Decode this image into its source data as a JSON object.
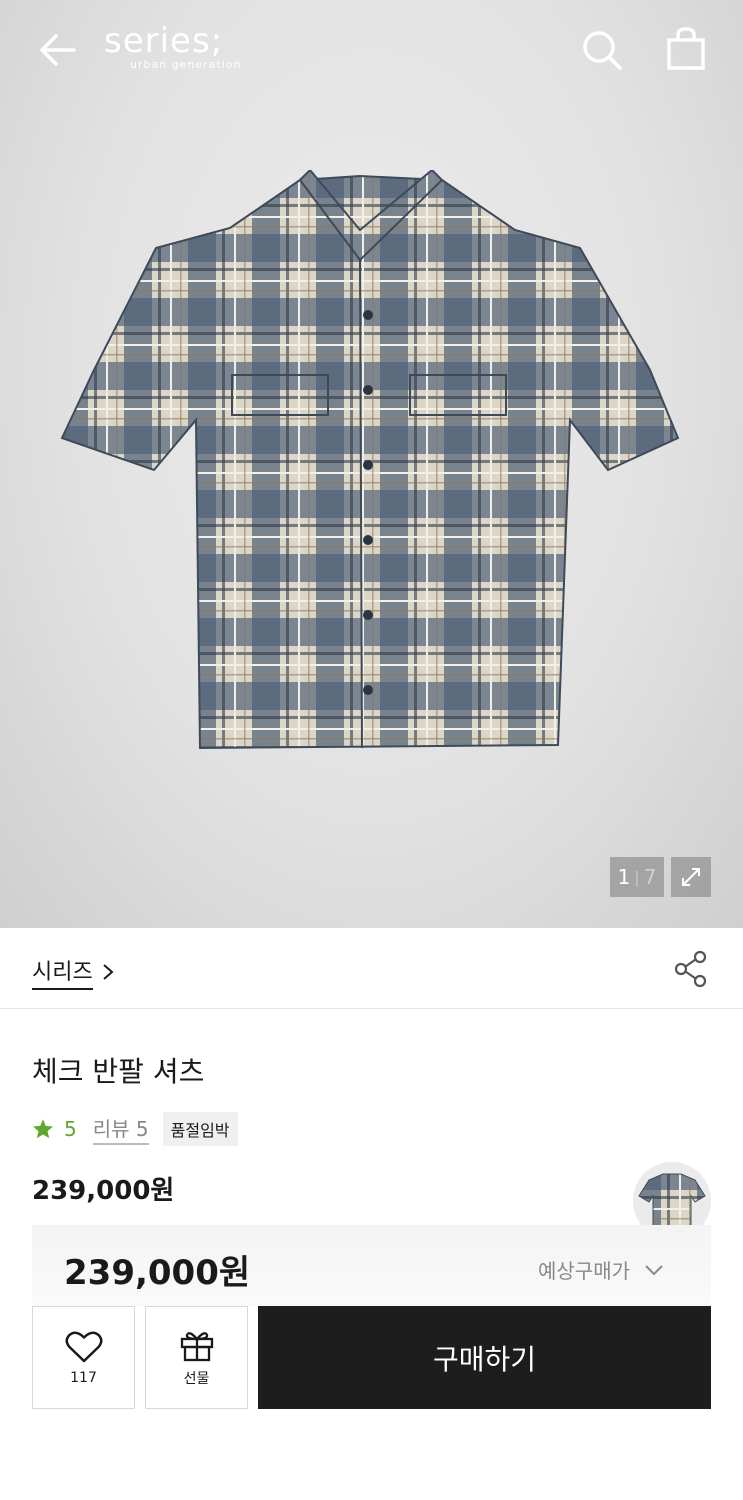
{
  "header": {
    "logo_main": "series;",
    "logo_sub": "urban generation",
    "back_icon": "arrow-left-icon",
    "search_icon": "search-icon",
    "bag_icon": "shopping-bag-icon"
  },
  "gallery": {
    "current": "1",
    "separator": "|",
    "total": "7",
    "expand_icon": "expand-icon"
  },
  "brand": {
    "name": "시리즈",
    "share_icon": "share-icon"
  },
  "product": {
    "title": "체크 반팔 셔츠",
    "rating": "5",
    "review_label": "리뷰 5",
    "badge": "품절임박",
    "price": "239,000원"
  },
  "purchase_bar": {
    "estimated_price": "239,000원",
    "estimated_label": "예상구매가",
    "like_count": "117",
    "gift_label": "선물",
    "buy_label": "구매하기"
  },
  "colors": {
    "accent_green": "#5fa82b",
    "buy_button": "#1d1d1d",
    "shirt_base": "#5a6b80"
  }
}
